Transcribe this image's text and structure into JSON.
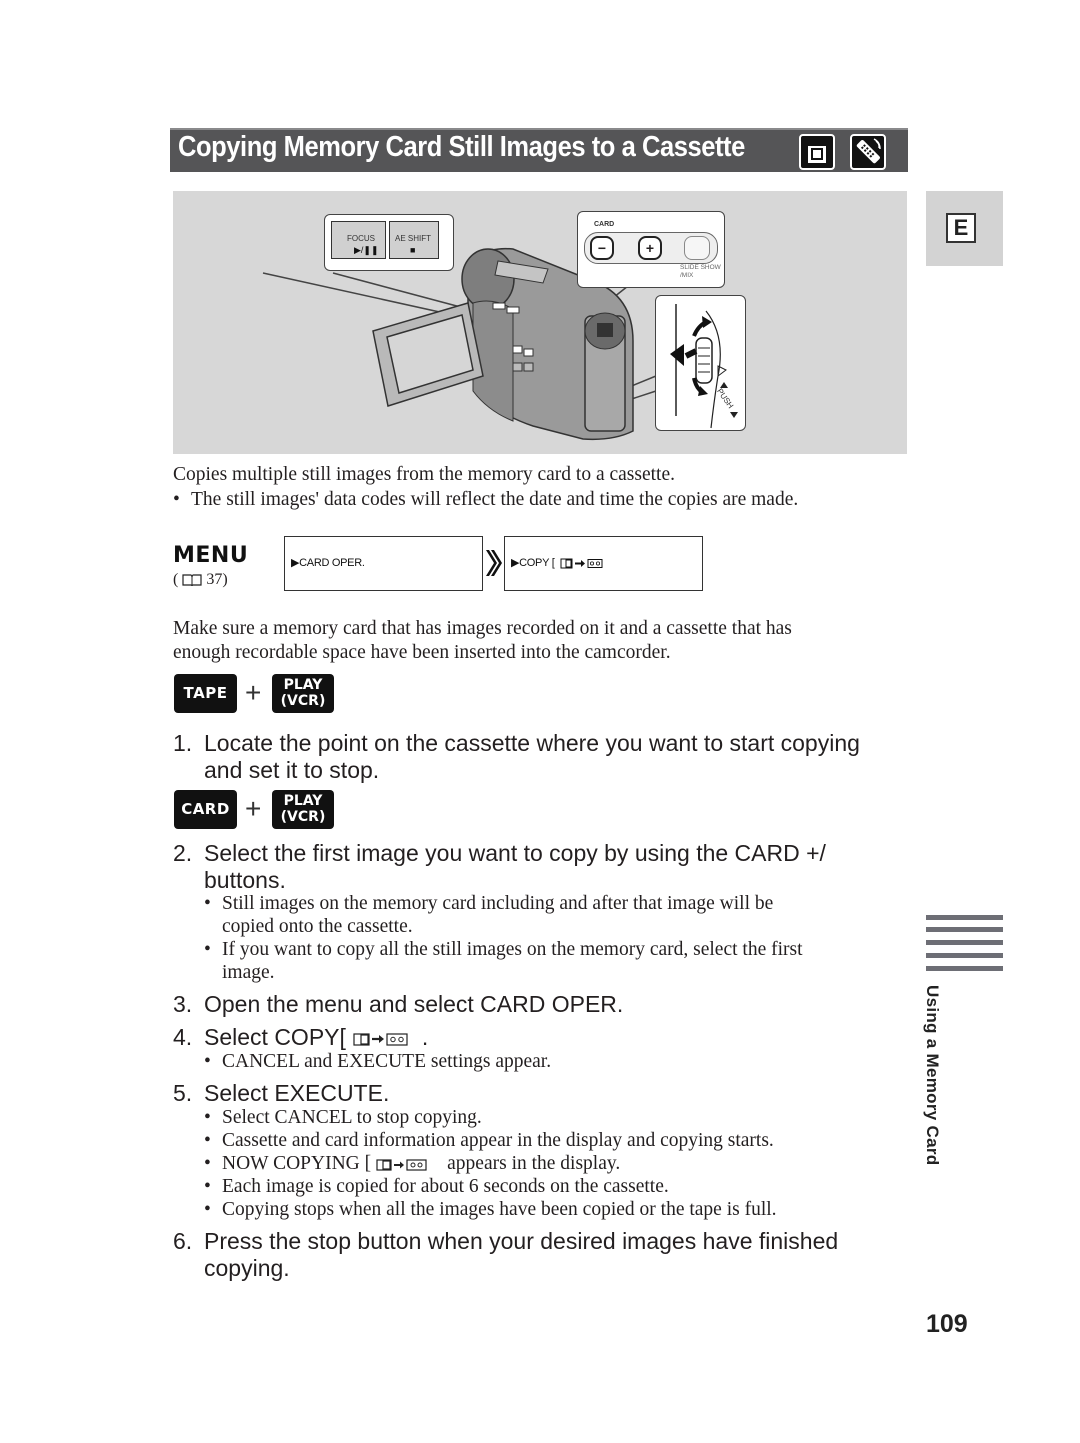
{
  "page": {
    "title": "Copying Memory Card Still Images to a Cassette",
    "title_icons": [
      "memory-card-icon",
      "remote-control-icon"
    ],
    "section_tab": "E",
    "side_label": "Using a Memory Card",
    "page_number": "109"
  },
  "illustration": {
    "callout_focus": {
      "label_1": "FOCUS",
      "symbol_1": "▶/❚❚",
      "label_2": "AE SHIFT",
      "symbol_2": "■"
    },
    "callout_card": {
      "label": "CARD",
      "minus": "−",
      "plus": "+",
      "slide_show_1": "SLIDE SHOW",
      "slide_show_2": "/MIX"
    },
    "callout_dial": {
      "push_label": "PUSH"
    }
  },
  "intro": {
    "text": "Copies multiple still images from the memory card to a cassette.",
    "bullet": "The still images' data codes will reflect the date and time the copies are made."
  },
  "menu": {
    "label": "MENU",
    "ref_open": "(",
    "ref_page": "37)",
    "step1": "▶CARD OPER.",
    "step2": "▶COPY [",
    "arrow": "»"
  },
  "prereq": {
    "line1": "Make sure a memory card that has images recorded on it and a cassette that has",
    "line2": "enough recordable space have been inserted into the camcorder."
  },
  "modes": [
    {
      "left": "TAPE",
      "plus": "+",
      "right_1": "PLAY",
      "right_2": "(VCR)"
    },
    {
      "left": "CARD",
      "plus": "+",
      "right_1": "PLAY",
      "right_2": "(VCR)"
    }
  ],
  "steps": [
    {
      "num": "1.",
      "lines": [
        "Locate the point on the cassette where you want to start copying",
        "and set it to stop."
      ],
      "bullets": []
    },
    {
      "num": "2.",
      "lines": [
        "Select the first image you want to copy by using the CARD +/",
        "buttons."
      ],
      "bullets": [
        [
          "Still images on the memory card including and after that image will be",
          "copied onto the cassette."
        ],
        [
          "If you want to copy all the still images on the memory card, select the first",
          "image."
        ]
      ]
    },
    {
      "num": "3.",
      "lines": [
        "Open the menu and select CARD OPER."
      ],
      "bullets": []
    },
    {
      "num": "4.",
      "lines": [
        "Select COPY[",
        "."
      ],
      "bullets": [
        [
          "CANCEL and EXECUTE settings appear."
        ]
      ]
    },
    {
      "num": "5.",
      "lines": [
        "Select EXECUTE."
      ],
      "bullets": [
        [
          "Select CANCEL to stop copying."
        ],
        [
          "Cassette and card information appear in the display and copying starts."
        ],
        [
          "NOW COPYING [",
          "appears in the display."
        ],
        [
          "Each image is copied for about 6 seconds on the cassette."
        ],
        [
          "Copying stops when all the images have been copied or the tape is full."
        ]
      ]
    },
    {
      "num": "6.",
      "lines": [
        "Press the stop button when your desired images have finished",
        "copying."
      ],
      "bullets": []
    }
  ],
  "bullet_char": "•"
}
